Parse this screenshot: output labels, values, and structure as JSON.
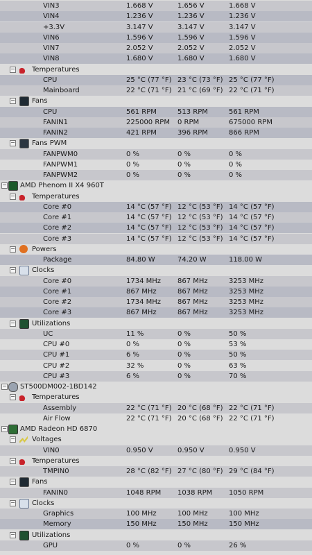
{
  "sensor_tree": {
    "rows": [
      {
        "level": 3,
        "label": "VIN3",
        "values": [
          "1.668 V",
          "1.656 V",
          "1.668 V"
        ],
        "style": "alt"
      },
      {
        "level": 3,
        "label": "VIN4",
        "values": [
          "1.236 V",
          "1.236 V",
          "1.236 V"
        ],
        "style": "sel"
      },
      {
        "level": 3,
        "label": "+3.3V",
        "values": [
          "3.147 V",
          "3.147 V",
          "3.147 V"
        ],
        "style": "alt"
      },
      {
        "level": 3,
        "label": "VIN6",
        "values": [
          "1.596 V",
          "1.596 V",
          "1.596 V"
        ],
        "style": "sel"
      },
      {
        "level": 3,
        "label": "VIN7",
        "values": [
          "2.052 V",
          "2.052 V",
          "2.052 V"
        ],
        "style": "alt"
      },
      {
        "level": 3,
        "label": "VIN8",
        "values": [
          "1.680 V",
          "1.680 V",
          "1.680 V"
        ],
        "style": "sel"
      },
      {
        "level": 2,
        "label": "Temperatures",
        "group": true,
        "icon": "thermometer-icon",
        "icon_class": "ic-temperatures",
        "values": [
          "",
          "",
          ""
        ],
        "style": ""
      },
      {
        "level": 3,
        "label": "CPU",
        "values": [
          "25 °C  (77 °F)",
          "23 °C  (73 °F)",
          "25 °C  (77 °F)"
        ],
        "style": "sel"
      },
      {
        "level": 3,
        "label": "Mainboard",
        "values": [
          "22 °C  (71 °F)",
          "21 °C  (69 °F)",
          "22 °C  (71 °F)"
        ],
        "style": "alt"
      },
      {
        "level": 2,
        "label": "Fans",
        "group": true,
        "icon": "fan-icon",
        "icon_class": "ic-fans",
        "values": [
          "",
          "",
          ""
        ],
        "style": ""
      },
      {
        "level": 3,
        "label": "CPU",
        "values": [
          "561 RPM",
          "513 RPM",
          "561 RPM"
        ],
        "style": "sel"
      },
      {
        "level": 3,
        "label": "FANIN1",
        "values": [
          "225000 RPM",
          "0 RPM",
          "675000 RPM"
        ],
        "style": "alt"
      },
      {
        "level": 3,
        "label": "FANIN2",
        "values": [
          "421 RPM",
          "396 RPM",
          "866 RPM"
        ],
        "style": "sel"
      },
      {
        "level": 2,
        "label": "Fans PWM",
        "group": true,
        "icon": "fan-pwm-icon",
        "icon_class": "ic-fans-pwm",
        "values": [
          "",
          "",
          ""
        ],
        "style": ""
      },
      {
        "level": 3,
        "label": "FANPWM0",
        "values": [
          "0 %",
          "0 %",
          "0 %"
        ],
        "style": "alt"
      },
      {
        "level": 3,
        "label": "FANPWM1",
        "values": [
          "0 %",
          "0 %",
          "0 %"
        ],
        "style": ""
      },
      {
        "level": 3,
        "label": "FANPWM2",
        "values": [
          "0 %",
          "0 %",
          "0 %"
        ],
        "style": "alt"
      },
      {
        "level": 1,
        "label": "AMD Phenom II X4 960T",
        "group": true,
        "icon": "cpu-chip-icon",
        "icon_class": "ic-cpu-chip",
        "values": [
          "",
          "",
          ""
        ],
        "style": ""
      },
      {
        "level": 2,
        "label": "Temperatures",
        "group": true,
        "icon": "thermometer-icon",
        "icon_class": "ic-temperatures",
        "values": [
          "",
          "",
          ""
        ],
        "style": ""
      },
      {
        "level": 3,
        "label": "Core #0",
        "values": [
          "14 °C  (57 °F)",
          "12 °C  (53 °F)",
          "14 °C  (57 °F)"
        ],
        "style": "sel"
      },
      {
        "level": 3,
        "label": "Core #1",
        "values": [
          "14 °C  (57 °F)",
          "12 °C  (53 °F)",
          "14 °C  (57 °F)"
        ],
        "style": "alt"
      },
      {
        "level": 3,
        "label": "Core #2",
        "values": [
          "14 °C  (57 °F)",
          "12 °C  (53 °F)",
          "14 °C  (57 °F)"
        ],
        "style": "sel"
      },
      {
        "level": 3,
        "label": "Core #3",
        "values": [
          "14 °C  (57 °F)",
          "12 °C  (53 °F)",
          "14 °C  (57 °F)"
        ],
        "style": "alt"
      },
      {
        "level": 2,
        "label": "Powers",
        "group": true,
        "icon": "power-icon",
        "icon_class": "ic-powers",
        "values": [
          "",
          "",
          ""
        ],
        "style": ""
      },
      {
        "level": 3,
        "label": "Package",
        "values": [
          "84.80 W",
          "74.20 W",
          "118.00 W"
        ],
        "style": "sel"
      },
      {
        "level": 2,
        "label": "Clocks",
        "group": true,
        "icon": "clock-icon",
        "icon_class": "ic-clocks",
        "values": [
          "",
          "",
          ""
        ],
        "style": ""
      },
      {
        "level": 3,
        "label": "Core #0",
        "values": [
          "1734 MHz",
          "867 MHz",
          "3253 MHz"
        ],
        "style": "alt"
      },
      {
        "level": 3,
        "label": "Core #1",
        "values": [
          "867 MHz",
          "867 MHz",
          "3253 MHz"
        ],
        "style": "sel"
      },
      {
        "level": 3,
        "label": "Core #2",
        "values": [
          "1734 MHz",
          "867 MHz",
          "3253 MHz"
        ],
        "style": "alt"
      },
      {
        "level": 3,
        "label": "Core #3",
        "values": [
          "867 MHz",
          "867 MHz",
          "3253 MHz"
        ],
        "style": "sel"
      },
      {
        "level": 2,
        "label": "Utilizations",
        "group": true,
        "icon": "utilization-icon",
        "icon_class": "ic-utilizations",
        "values": [
          "",
          "",
          ""
        ],
        "style": ""
      },
      {
        "level": 3,
        "label": "UC",
        "values": [
          "11 %",
          "0 %",
          "50 %"
        ],
        "style": "alt"
      },
      {
        "level": 3,
        "label": "CPU #0",
        "values": [
          "0 %",
          "0 %",
          "53 %"
        ],
        "style": ""
      },
      {
        "level": 3,
        "label": "CPU #1",
        "values": [
          "6 %",
          "0 %",
          "50 %"
        ],
        "style": "alt"
      },
      {
        "level": 3,
        "label": "CPU #2",
        "values": [
          "32 %",
          "0 %",
          "63 %"
        ],
        "style": ""
      },
      {
        "level": 3,
        "label": "CPU #3",
        "values": [
          "6 %",
          "0 %",
          "70 %"
        ],
        "style": "alt"
      },
      {
        "level": 1,
        "label": "ST500DM002-1BD142",
        "group": true,
        "icon": "hard-disk-icon",
        "icon_class": "ic-disk",
        "values": [
          "",
          "",
          ""
        ],
        "style": ""
      },
      {
        "level": 2,
        "label": "Temperatures",
        "group": true,
        "icon": "thermometer-icon",
        "icon_class": "ic-temperatures",
        "values": [
          "",
          "",
          ""
        ],
        "style": ""
      },
      {
        "level": 3,
        "label": "Assembly",
        "values": [
          "22 °C  (71 °F)",
          "20 °C  (68 °F)",
          "22 °C  (71 °F)"
        ],
        "style": "alt"
      },
      {
        "level": 3,
        "label": "Air Flow",
        "values": [
          "22 °C  (71 °F)",
          "20 °C  (68 °F)",
          "22 °C  (71 °F)"
        ],
        "style": ""
      },
      {
        "level": 1,
        "label": "AMD Radeon HD 6870",
        "group": true,
        "icon": "gpu-card-icon",
        "icon_class": "ic-gpu-card",
        "values": [
          "",
          "",
          ""
        ],
        "style": ""
      },
      {
        "level": 2,
        "label": "Voltages",
        "group": true,
        "icon": "voltage-icon",
        "icon_class": "ic-voltages",
        "values": [
          "",
          "",
          ""
        ],
        "style": ""
      },
      {
        "level": 3,
        "label": "VIN0",
        "values": [
          "0.950 V",
          "0.950 V",
          "0.950 V"
        ],
        "style": "alt"
      },
      {
        "level": 2,
        "label": "Temperatures",
        "group": true,
        "icon": "thermometer-icon",
        "icon_class": "ic-temperatures",
        "values": [
          "",
          "",
          ""
        ],
        "style": ""
      },
      {
        "level": 3,
        "label": "TMPIN0",
        "values": [
          "28 °C  (82 °F)",
          "27 °C  (80 °F)",
          "29 °C  (84 °F)"
        ],
        "style": "alt"
      },
      {
        "level": 2,
        "label": "Fans",
        "group": true,
        "icon": "fan-icon",
        "icon_class": "ic-fans",
        "values": [
          "",
          "",
          ""
        ],
        "style": ""
      },
      {
        "level": 3,
        "label": "FANIN0",
        "values": [
          "1048 RPM",
          "1038 RPM",
          "1050 RPM"
        ],
        "style": "alt"
      },
      {
        "level": 2,
        "label": "Clocks",
        "group": true,
        "icon": "clock-icon",
        "icon_class": "ic-clocks",
        "values": [
          "",
          "",
          ""
        ],
        "style": ""
      },
      {
        "level": 3,
        "label": "Graphics",
        "values": [
          "100 MHz",
          "100 MHz",
          "100 MHz"
        ],
        "style": "alt"
      },
      {
        "level": 3,
        "label": "Memory",
        "values": [
          "150 MHz",
          "150 MHz",
          "150 MHz"
        ],
        "style": "sel"
      },
      {
        "level": 2,
        "label": "Utilizations",
        "group": true,
        "icon": "utilization-icon",
        "icon_class": "ic-utilizations",
        "values": [
          "",
          "",
          ""
        ],
        "style": ""
      },
      {
        "level": 3,
        "label": "GPU",
        "values": [
          "0 %",
          "0 %",
          "26 %"
        ],
        "style": "alt"
      }
    ]
  },
  "colors": {
    "background": "#dcdcdc",
    "row_alt": "#c7c7cc",
    "row_selected": "#b8bac4",
    "text": "#1a1a1a"
  }
}
